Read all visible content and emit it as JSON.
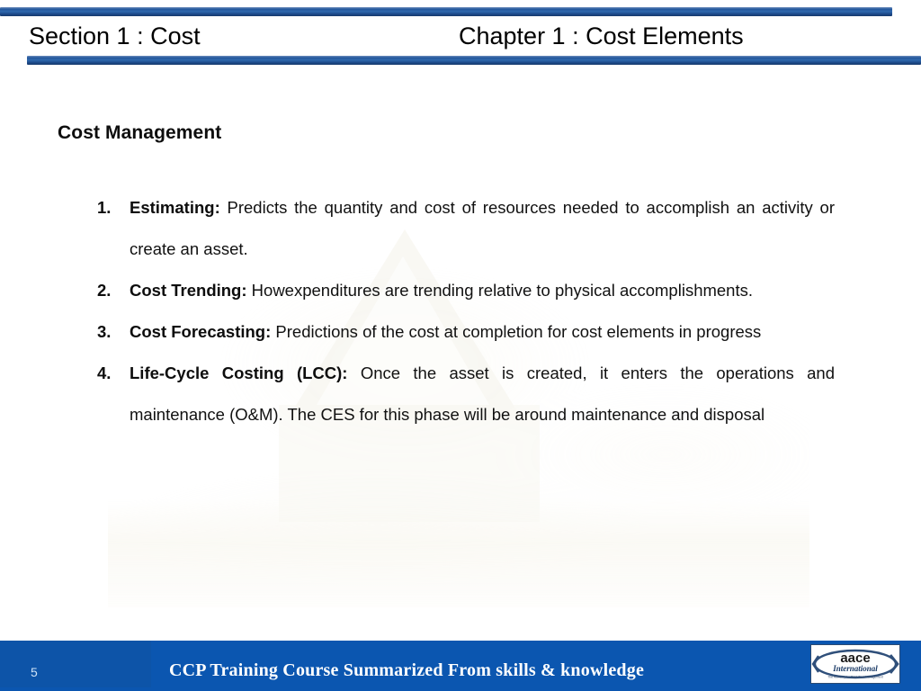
{
  "header": {
    "left_title": "Section 1 : Cost",
    "right_title": "Chapter 1 : Cost Elements",
    "bar_color": "#24579c"
  },
  "body": {
    "heading": "Cost Management",
    "items": [
      {
        "marker": "1.",
        "term": "Estimating:",
        "text": " Predicts the quantity and cost of resources needed to accomplish an activity or create an asset."
      },
      {
        "marker": "2.",
        "term": "Cost Trending:",
        "text": " Howexpenditures are trending relative to physical accomplishments."
      },
      {
        "marker": "3.",
        "term": "Cost Forecasting:",
        "text": " Predictions of the cost at completion for cost elements in progress"
      },
      {
        "marker": "4.",
        "term": "Life-Cycle Costing (LCC):",
        "text": " Once the asset is created, it enters the operations and maintenance (O&M). The CES for this phase will be around maintenance and disposal"
      }
    ]
  },
  "footer": {
    "page_number": "5",
    "text": "CCP Training Course Summarized From skills & knowledge",
    "band_color": "#0b56b0",
    "logo": {
      "name": "aace-international-logo",
      "primary_text": "aace",
      "secondary_text": "International",
      "tagline": "The Authority for Total Cost Management"
    }
  }
}
